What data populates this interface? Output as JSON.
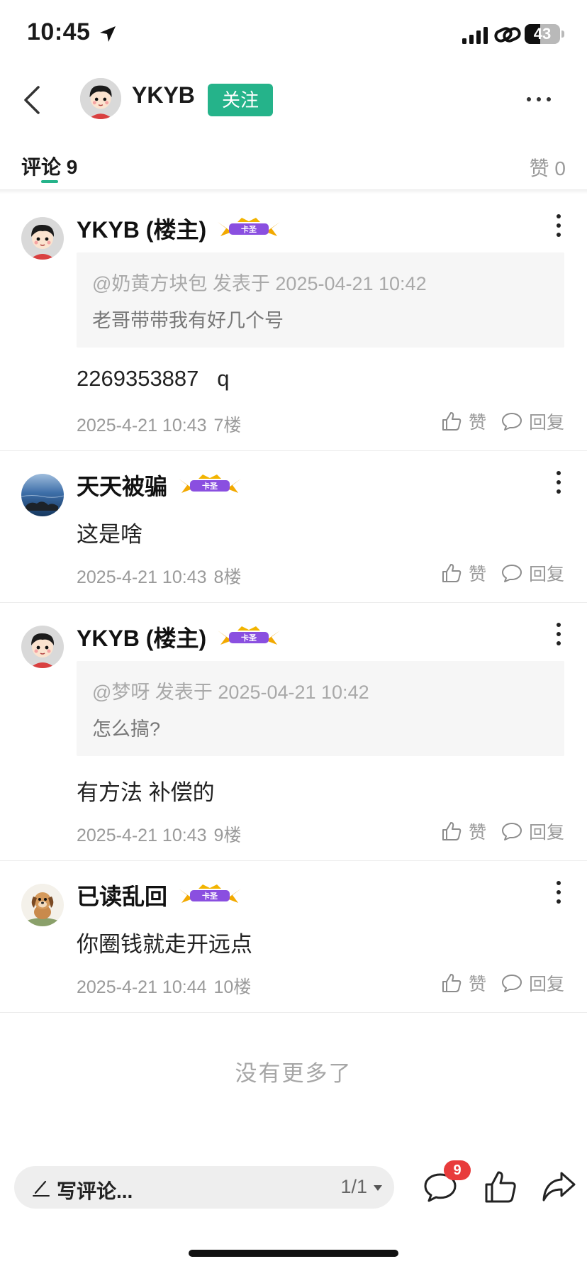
{
  "status_bar": {
    "time": "10:45",
    "battery_level": "43",
    "battery_fraction": 0.43
  },
  "header": {
    "author_name": "YKYB",
    "follow_label": "关注"
  },
  "tabs": {
    "comments_label": "评论 9",
    "likes_label": "赞 0"
  },
  "comments": [
    {
      "author": "YKYB (楼主)",
      "quote_header": "@奶黄方块包 发表于 2025-04-21 10:42",
      "quote_body": "老哥带带我有好几个号",
      "text": "2269353887   q",
      "time": "2025-4-21 10:43",
      "floor": "7楼",
      "like_label": "赞",
      "reply_label": "回复"
    },
    {
      "author": "天天被骗",
      "text": "这是啥",
      "time": "2025-4-21 10:43",
      "floor": "8楼",
      "like_label": "赞",
      "reply_label": "回复"
    },
    {
      "author": "YKYB (楼主)",
      "quote_header": "@梦呀 发表于 2025-04-21 10:42",
      "quote_body": "怎么搞?",
      "text": "有方法 补偿的",
      "time": "2025-4-21 10:43",
      "floor": "9楼",
      "like_label": "赞",
      "reply_label": "回复"
    },
    {
      "author": "已读乱回",
      "text": "你圈钱就走开远点",
      "time": "2025-4-21 10:44",
      "floor": "10楼",
      "like_label": "赞",
      "reply_label": "回复"
    }
  ],
  "badge_text": "卡圣",
  "footer_text": "没有更多了",
  "bottom_bar": {
    "input_placeholder": "写评论...",
    "page_indicator": "1/1",
    "comment_count": "9"
  },
  "colors": {
    "accent": "#25b38a",
    "badge_red": "#e83b3b",
    "badge_purple": "#8a4fe0",
    "badge_gold": "#f2a900"
  }
}
